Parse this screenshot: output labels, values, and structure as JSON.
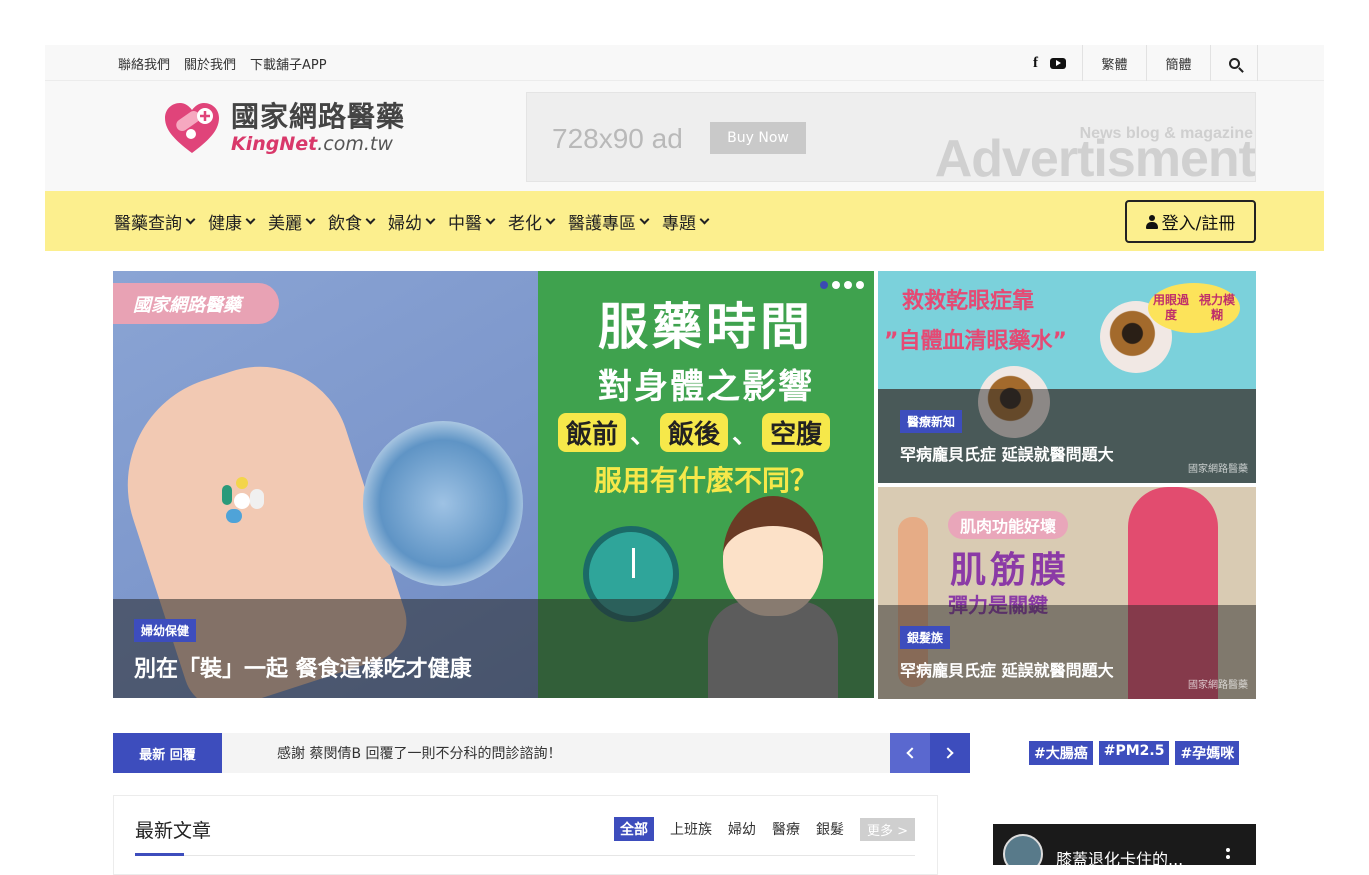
{
  "topbar": {
    "links": [
      "聯絡我們",
      "關於我們",
      "下載舖子APP"
    ],
    "lang_trad": "繁體",
    "lang_simp": "簡體"
  },
  "logo": {
    "cn": "國家網路醫藥",
    "en_brand": "KingNet",
    "en_domain": ".com.tw"
  },
  "ad": {
    "size": "728x90 ad",
    "buy": "Buy Now",
    "news": "News blog & magazine",
    "big": "Advertisment"
  },
  "nav": {
    "items": [
      "醫藥查詢",
      "健康",
      "美麗",
      "飲食",
      "婦幼",
      "中醫",
      "老化",
      "醫護專區",
      "專題"
    ],
    "login": "登入/註冊"
  },
  "hero": {
    "badge": "國家網路醫藥",
    "title1": "服藥時間",
    "title2": "對身體之影響",
    "tag1": "飯前",
    "sep": "、",
    "tag2": "飯後",
    "tag3": "空腹",
    "question": "服用有什麼不同？",
    "category": "婦幼保健",
    "caption": "別在「裝」一起 餐食這樣吃才健康"
  },
  "card1": {
    "line1": "救救乾眼症靠",
    "line2": "”自體血清眼藥水”",
    "bubble1": "用眼過度",
    "bubble2": "視力模糊",
    "category": "醫療新知",
    "caption": "罕病龐貝氏症 延誤就醫問題大",
    "watermark": "國家網路醫藥"
  },
  "card2": {
    "tag": "肌肉功能好壞",
    "big": "肌筋膜",
    "sub": "彈力是關鍵",
    "category": "銀髮族",
    "caption": "罕病龐貝氏症 延誤就醫問題大",
    "watermark": "國家網路醫藥"
  },
  "ticker": {
    "label": "最新 回覆",
    "text": "感謝 蔡閔倩B 回覆了一則不分科的問診諮詢！"
  },
  "hashtags": [
    "#大腸癌",
    "#PM2.5",
    "#孕媽咪"
  ],
  "latest": {
    "title": "最新文章",
    "tabs": [
      "全部",
      "上班族",
      "婦幼",
      "醫療",
      "銀髮"
    ],
    "more": "更多 >"
  },
  "video": {
    "title": "膝蓋退化卡住的..."
  },
  "colors": {
    "accent": "#3d4dbd",
    "nav_bg": "#fcef8e",
    "pink": "#e54a74"
  }
}
